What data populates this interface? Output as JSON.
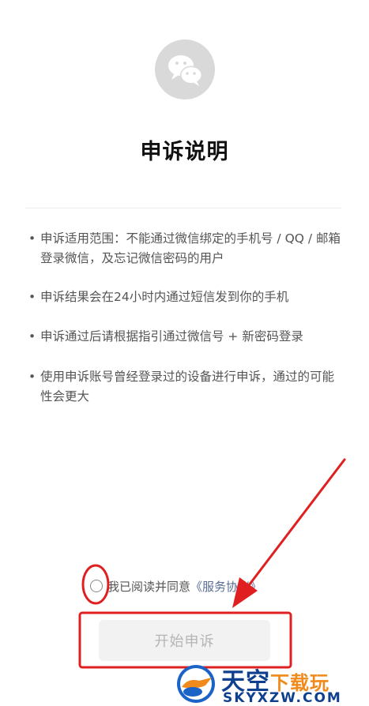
{
  "header": {
    "logo_icon": "wechat-icon",
    "title": "申诉说明"
  },
  "bullets": [
    {
      "marker": "•",
      "text": "申诉适用范围：不能通过微信绑定的手机号 / QQ / 邮箱登录微信，及忘记微信密码的用户"
    },
    {
      "marker": "•",
      "text": "申诉结果会在24小时内通过短信发到你的手机"
    },
    {
      "marker": "•",
      "text": "申诉通过后请根据指引通过微信号 + 新密码登录"
    },
    {
      "marker": "•",
      "text": "使用申诉账号曾经登录过的设备进行申诉，通过的可能性会更大"
    }
  ],
  "agreement": {
    "text": "我已阅读并同意",
    "link": "《服务协议》",
    "checked": false
  },
  "start_button": {
    "label": "开始申诉",
    "enabled": false
  },
  "annotation": {
    "color": "#e02020"
  },
  "watermark": {
    "cn_main": "天空",
    "cn_sub": "下载玩",
    "en": "SKYXZW.COM"
  },
  "colors": {
    "logo_bg": "#d9d9d9",
    "text": "#555555",
    "link": "#576b95",
    "button_bg": "#f2f2f2",
    "button_text": "#b5b5b5"
  }
}
